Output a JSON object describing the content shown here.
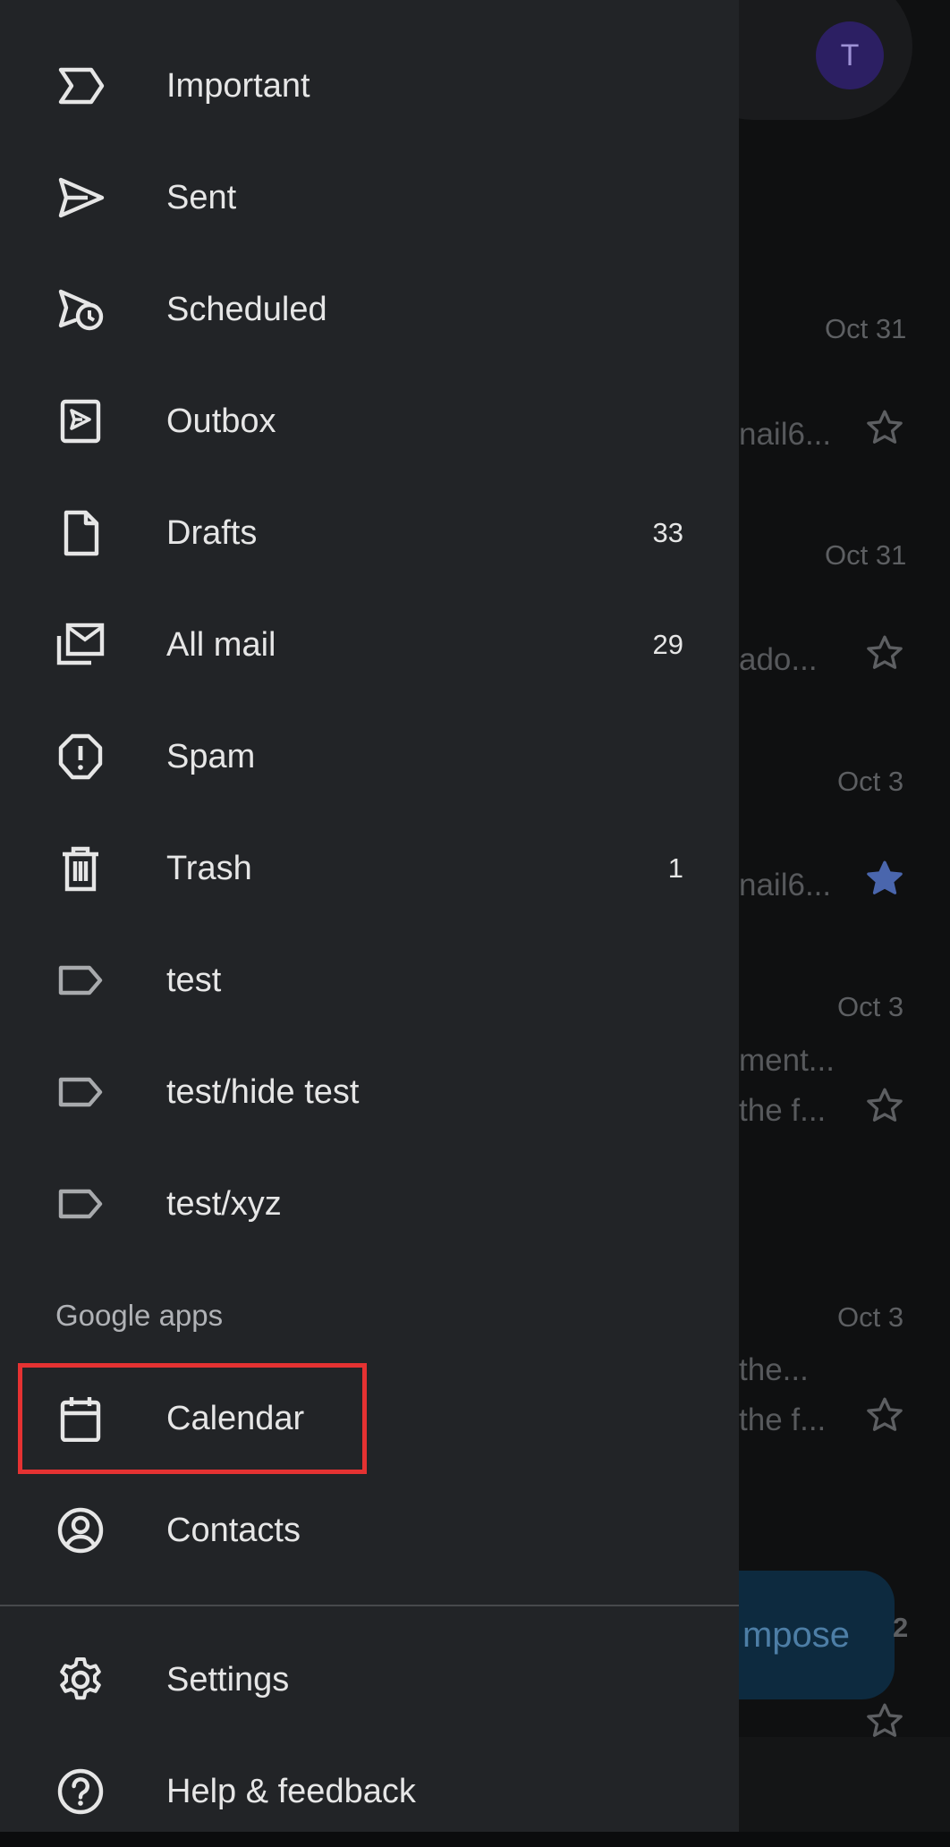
{
  "drawer": {
    "items": [
      {
        "label": "Important",
        "count": "",
        "icon": "important-icon"
      },
      {
        "label": "Sent",
        "count": "",
        "icon": "send-icon"
      },
      {
        "label": "Scheduled",
        "count": "",
        "icon": "scheduled-send-icon"
      },
      {
        "label": "Outbox",
        "count": "",
        "icon": "outbox-icon"
      },
      {
        "label": "Drafts",
        "count": "33",
        "icon": "draft-icon"
      },
      {
        "label": "All mail",
        "count": "29",
        "icon": "all-mail-icon"
      },
      {
        "label": "Spam",
        "count": "",
        "icon": "spam-icon"
      },
      {
        "label": "Trash",
        "count": "1",
        "icon": "trash-icon"
      },
      {
        "label": "test",
        "count": "",
        "icon": "label-icon"
      },
      {
        "label": "test/hide test",
        "count": "",
        "icon": "label-icon"
      },
      {
        "label": "test/xyz",
        "count": "",
        "icon": "label-icon"
      }
    ],
    "google_apps_label": "Google apps",
    "apps": [
      {
        "label": "Calendar",
        "icon": "calendar-icon"
      },
      {
        "label": "Contacts",
        "icon": "contacts-icon"
      }
    ],
    "footer": [
      {
        "label": "Settings",
        "icon": "gear-icon"
      },
      {
        "label": "Help & feedback",
        "icon": "help-icon"
      }
    ]
  },
  "background": {
    "avatar_letter": "T",
    "emails": [
      {
        "date": "Oct 31",
        "snippet": "nail6...",
        "starred": false
      },
      {
        "date": "Oct 31",
        "snippet": "ado...",
        "starred": false
      },
      {
        "date": "Oct 3",
        "snippet": "nail6...",
        "starred": true
      },
      {
        "date": "Oct 3",
        "snippet": "ment...",
        "snippet2": "the f...",
        "starred": false
      },
      {
        "date": "Oct 3",
        "snippet": "the...",
        "snippet2": "the f...",
        "starred": false
      }
    ],
    "compose_label": "mpose",
    "compose_sub": "2"
  },
  "colors": {
    "drawer_bg": "#222427",
    "highlight": "#e53232",
    "star_filled": "#5b7fd4"
  }
}
